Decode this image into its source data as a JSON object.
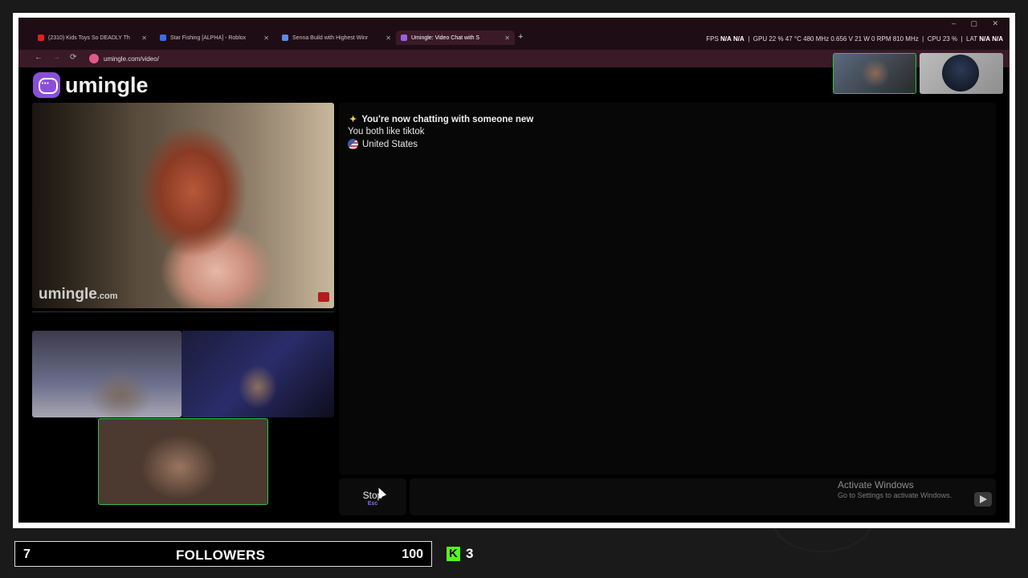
{
  "browser": {
    "tabs": [
      {
        "label": "(2310) Kids Toys So DEADLY Th",
        "favicon_color": "#e02020"
      },
      {
        "label": "Star Fishing [ALPHA] - Roblox",
        "favicon_color": "#3a6ee8"
      },
      {
        "label": "Senna Build with Highest Winr",
        "favicon_color": "#5a8ae8"
      },
      {
        "label": "Umingle: Video Chat with S",
        "favicon_color": "#9b5ee6",
        "active": true
      }
    ],
    "new_tab": "+",
    "url": "umingle.com/video/",
    "nav": {
      "back": "←",
      "forward": "→",
      "reload": "⟳"
    },
    "window_controls": "– ▢ ✕"
  },
  "stats_overlay": {
    "fps_label": "FPS",
    "fps_1": "N/A",
    "fps_2": "N/A",
    "gpu": "GPU 22 % 47 °C 480 MHz 0.656 V 21 W 0 RPM 810 MHz",
    "cpu": "CPU 23 %",
    "lat_label": "LAT",
    "lat_1": "N/A",
    "lat_2": "N/A"
  },
  "site": {
    "logo_text": "umingle",
    "watermark": "umingle",
    "watermark_suffix": ".com"
  },
  "chat": {
    "notice": "You're now chatting with someone new",
    "common_interest": "You both like tiktok",
    "country": "United States"
  },
  "controls": {
    "stop_label": "Stop",
    "stop_hint": "Esc",
    "activate_title": "Activate Windows",
    "activate_sub": "Go to Settings to activate Windows."
  },
  "stream_overlay": {
    "follower_count": "7",
    "follower_label": "FOLLOWERS",
    "follower_goal": "100",
    "kick_count": "3"
  },
  "colors": {
    "accent": "#8b4fd6",
    "self_border": "#2cbf4b",
    "kick_green": "#53fc18"
  }
}
